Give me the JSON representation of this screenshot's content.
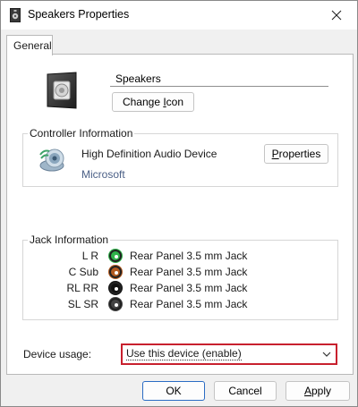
{
  "window": {
    "title": "Speakers Properties",
    "close_glyph": "✕",
    "icon": "speaker-window-icon"
  },
  "tabs": [
    {
      "label": "General",
      "selected": true
    }
  ],
  "device": {
    "name": "Speakers",
    "icon": "speaker-icon",
    "change_icon_label_pre": "Change ",
    "change_icon_label_accel": "I",
    "change_icon_label_post": "con"
  },
  "controller": {
    "group_label": "Controller Information",
    "name": "High Definition Audio Device",
    "vendor": "Microsoft",
    "icon": "audio-controller-icon",
    "properties_accel": "P",
    "properties_rest": "roperties"
  },
  "jacks": {
    "group_label": "Jack Information",
    "items": [
      {
        "channels": "L R",
        "color": "#2fb34a",
        "description": "Rear Panel 3.5 mm Jack"
      },
      {
        "channels": "C Sub",
        "color": "#b35a1f",
        "description": "Rear Panel 3.5 mm Jack"
      },
      {
        "channels": "RL RR",
        "color": "#111111",
        "description": "Rear Panel 3.5 mm Jack"
      },
      {
        "channels": "SL SR",
        "color": "#444444",
        "description": "Rear Panel 3.5 mm Jack"
      }
    ]
  },
  "usage": {
    "label": "Device usage:",
    "selected": "Use this device (enable)",
    "highlight_color": "#c8202e"
  },
  "buttons": {
    "ok": "OK",
    "cancel": "Cancel",
    "apply_accel": "A",
    "apply_rest": "pply"
  }
}
